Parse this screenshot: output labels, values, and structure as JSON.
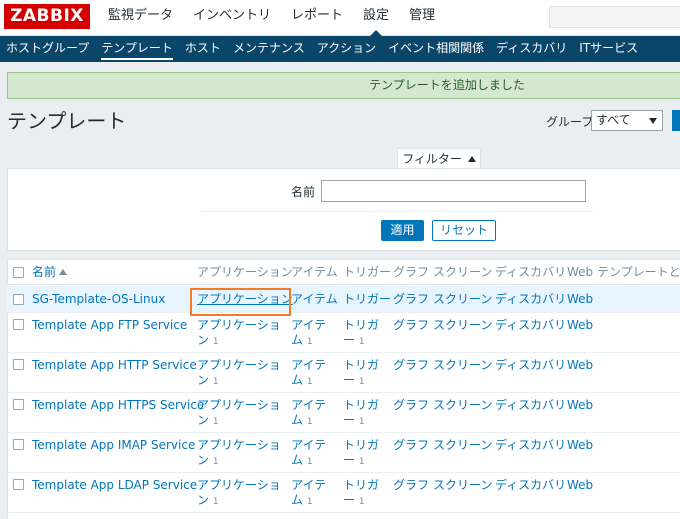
{
  "header": {
    "logo": "ZABBIX",
    "menu": [
      "監視データ",
      "インベントリ",
      "レポート",
      "設定",
      "管理"
    ],
    "active_menu_index": 3
  },
  "submenu": {
    "items": [
      "ホストグループ",
      "テンプレート",
      "ホスト",
      "メンテナンス",
      "アクション",
      "イベント相関関係",
      "ディスカバリ",
      "ITサービス"
    ],
    "active_index": 1
  },
  "message": "テンプレートを追加しました",
  "page": {
    "title": "テンプレート",
    "group_label": "グループ",
    "group_value": "すべて"
  },
  "filter": {
    "tab_label": "フィルター",
    "name_label": "名前",
    "name_value": "",
    "apply_label": "適用",
    "reset_label": "リセット"
  },
  "table": {
    "columns": [
      "名前",
      "アプリケーション",
      "アイテム",
      "トリガー",
      "グラフ",
      "スクリーン",
      "ディスカバリ",
      "Web",
      "テンプレートとの"
    ],
    "rows": [
      {
        "name": "SG-Template-OS-Linux",
        "applications": "アプリケーション",
        "items": "アイテム",
        "triggers": "トリガー",
        "graphs": "グラフ",
        "screens": "スクリーン",
        "discovery": "ディスカバリ",
        "web": "Web"
      },
      {
        "name": "Template App FTP Service",
        "applications": "アプリケーショ",
        "applications_tail": "ン",
        "applications_count": "1",
        "items": "アイテ",
        "items_tail": "ム",
        "items_count": "1",
        "triggers": "トリガ",
        "triggers_tail": "ー",
        "triggers_count": "1",
        "graphs": "グラフ",
        "screens": "スクリーン",
        "discovery": "ディスカバリ",
        "web": "Web"
      },
      {
        "name": "Template App HTTP Service",
        "applications": "アプリケーショ",
        "applications_tail": "ン",
        "applications_count": "1",
        "items": "アイテ",
        "items_tail": "ム",
        "items_count": "1",
        "triggers": "トリガ",
        "triggers_tail": "ー",
        "triggers_count": "1",
        "graphs": "グラフ",
        "screens": "スクリーン",
        "discovery": "ディスカバリ",
        "web": "Web"
      },
      {
        "name": "Template App HTTPS Service",
        "applications": "アプリケーショ",
        "applications_tail": "ン",
        "applications_count": "1",
        "items": "アイテ",
        "items_tail": "ム",
        "items_count": "1",
        "triggers": "トリガ",
        "triggers_tail": "ー",
        "triggers_count": "1",
        "graphs": "グラフ",
        "screens": "スクリーン",
        "discovery": "ディスカバリ",
        "web": "Web"
      },
      {
        "name": "Template App IMAP Service",
        "applications": "アプリケーショ",
        "applications_tail": "ン",
        "applications_count": "1",
        "items": "アイテ",
        "items_tail": "ム",
        "items_count": "1",
        "triggers": "トリガ",
        "triggers_tail": "ー",
        "triggers_count": "1",
        "graphs": "グラフ",
        "screens": "スクリーン",
        "discovery": "ディスカバリ",
        "web": "Web"
      },
      {
        "name": "Template App LDAP Service",
        "applications": "アプリケーショ",
        "applications_tail": "ン",
        "applications_count": "1",
        "items": "アイテ",
        "items_tail": "ム",
        "items_count": "1",
        "triggers": "トリガ",
        "triggers_tail": "ー",
        "triggers_count": "1",
        "graphs": "グラフ",
        "screens": "スクリーン",
        "discovery": "ディスカバリ",
        "web": "Web"
      }
    ]
  },
  "colors": {
    "brand": "#d40000",
    "nav": "#0a466a",
    "link": "#0275b8",
    "success_bg": "#d3e8cf",
    "highlight": "#f07c2a"
  }
}
